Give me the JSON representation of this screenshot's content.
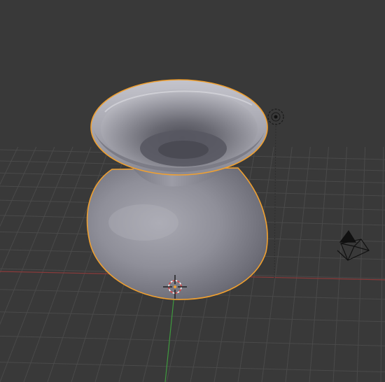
{
  "viewport": {
    "background_color": "#393939",
    "grid_color": "#4a4a4a",
    "x_axis_color": "#8b3a3a",
    "y_axis_color": "#3f9a3f",
    "selection_outline_color": "#f0a030",
    "object": {
      "name": "vase-mesh",
      "shading": "solid",
      "selected": true
    },
    "icons": {
      "cursor": "3d-cursor-icon",
      "light": "lamp-icon",
      "camera": "camera-icon"
    }
  }
}
